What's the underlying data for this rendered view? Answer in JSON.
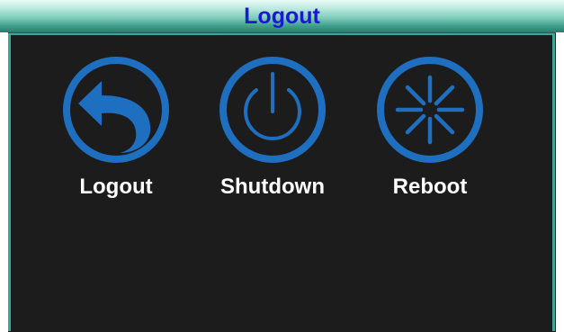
{
  "window": {
    "title": "Logout"
  },
  "options": [
    {
      "label": "Logout",
      "icon": "logout-arrow-icon"
    },
    {
      "label": "Shutdown",
      "icon": "power-icon"
    },
    {
      "label": "Reboot",
      "icon": "reboot-icon"
    }
  ],
  "colors": {
    "title_text": "#1a1acc",
    "icon_blue": "#1e6fc0",
    "frame_teal": "#3aa79a",
    "background": "#1c1c1c",
    "label_text": "#ffffff"
  }
}
